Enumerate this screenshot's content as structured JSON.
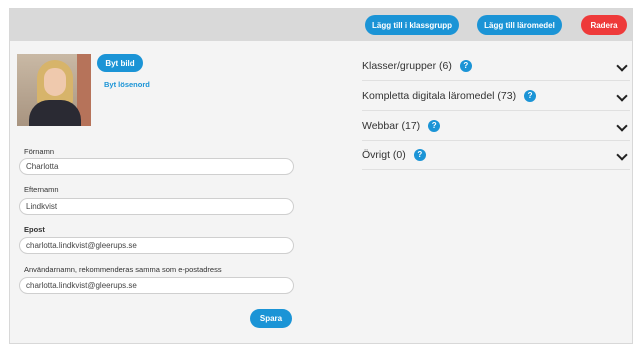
{
  "toolbar": {
    "add_class_label": "Lägg till i klassgrupp",
    "add_material_label": "Lägg till läromedel",
    "delete_label": "Radera"
  },
  "profile": {
    "change_photo_label": "Byt bild",
    "change_password_label": "Byt lösenord"
  },
  "form": {
    "first_name_label": "Förnamn",
    "first_name_value": "Charlotta",
    "last_name_label": "Efternamn",
    "last_name_value": "Lindkvist",
    "email_label": "Epost",
    "email_value": "charlotta.lindkvist@gleerups.se",
    "username_label": "Användarnamn, rekommenderas samma som e-postadress",
    "username_value": "charlotta.lindkvist@gleerups.se",
    "save_label": "Spara"
  },
  "accordion": [
    {
      "title": "Klasser/grupper (6)"
    },
    {
      "title": "Kompletta digitala läromedel (73)"
    },
    {
      "title": "Webbar (17)"
    },
    {
      "title": "Övrigt (0)"
    }
  ],
  "help_glyph": "?",
  "colors": {
    "accent": "#1b94d6",
    "danger": "#ee3a3a",
    "topbar": "#d9d9d9"
  }
}
